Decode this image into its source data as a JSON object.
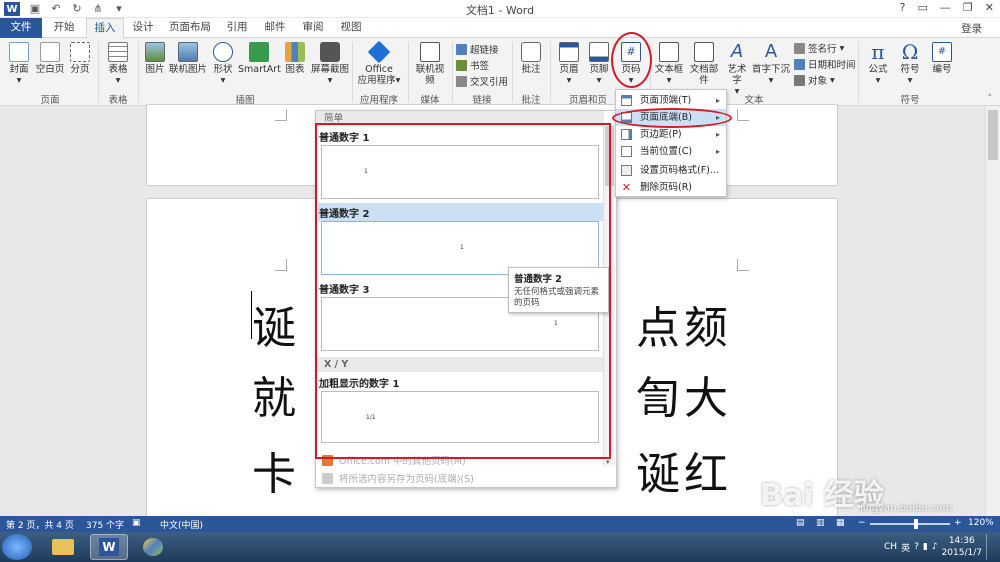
{
  "titlebar": {
    "title": "文档1 - Word",
    "help": "?",
    "minimize": "—",
    "restore": "❐",
    "close": "✕"
  },
  "tabs": [
    {
      "label": "文件"
    },
    {
      "label": "开始"
    },
    {
      "label": "插入"
    },
    {
      "label": "设计"
    },
    {
      "label": "页面布局"
    },
    {
      "label": "引用"
    },
    {
      "label": "邮件"
    },
    {
      "label": "审阅"
    },
    {
      "label": "视图"
    }
  ],
  "login": "登录",
  "ribbon": {
    "cover": "封面",
    "blank_page": "空白页",
    "page_break": "分页",
    "table": "表格",
    "picture": "图片",
    "online_picture": "联机图片",
    "shapes": "形状",
    "smartart": "SmartArt",
    "chart": "图表",
    "screenshot": "屏幕截图",
    "office_apps_1": "Office",
    "office_apps_2": "应用程序",
    "online_video": "联机视频",
    "hyperlink": "超链接",
    "bookmark": "书签",
    "cross_ref": "交叉引用",
    "comment": "批注",
    "header": "页眉",
    "footer": "页脚",
    "page_number": "页码",
    "textbox": "文本框",
    "quick_parts": "文档部件",
    "wordart": "艺术字",
    "drop_cap": "首字下沉",
    "signature": "签名行",
    "datetime": "日期和时间",
    "object": "对象",
    "equation": "公式",
    "symbol": "符号",
    "number": "编号",
    "groups": {
      "pages": "页面",
      "tables": "表格",
      "illustrations": "插图",
      "apps": "应用程序",
      "media": "媒体",
      "links": "链接",
      "comments": "批注",
      "header_footer": "页眉和页",
      "text": "文本",
      "symbols": "符号"
    }
  },
  "document": {
    "line1_left": "诞",
    "line1_right": "点颏",
    "line2_left": "就",
    "line2_right": "訇大",
    "line3_left": "卡",
    "line3_right": "诞红"
  },
  "gallery": {
    "cat_simple": "简单",
    "item1": "普通数字 1",
    "item2": "普通数字 2",
    "item3": "普通数字 3",
    "cat_xy": "X / Y",
    "item4": "加粗显示的数字 1",
    "num1": "1",
    "num2": "1",
    "num3": "1",
    "num4": "1/1",
    "more_office": "Office.com 中的其他页码(M)",
    "save_selection": "将所选内容另存为页码(底端)(S)"
  },
  "context_menu": {
    "top": "页面顶端(T)",
    "bottom": "页面底端(B)",
    "margins": "页边距(P)",
    "current": "当前位置(C)",
    "format": "设置页码格式(F)...",
    "remove": "删除页码(R)"
  },
  "tooltip": {
    "title": "普通数字 2",
    "desc": "无任何格式或强调元素的页码"
  },
  "statusbar": {
    "page": "第 2 页，共 4 页",
    "words": "375 个字",
    "lang": "中文(中国)",
    "zoom": "120%"
  },
  "taskbar": {
    "time": "14:36",
    "date": "2015/1/7",
    "ime": "CH",
    "ime2": "英"
  },
  "watermark": {
    "brand": "Bai 经验",
    "url": "jingyan.baidu.com"
  },
  "colors": {
    "accent": "#2b579a",
    "highlight": "#cde0f3",
    "annotation": "#d11a2a"
  }
}
